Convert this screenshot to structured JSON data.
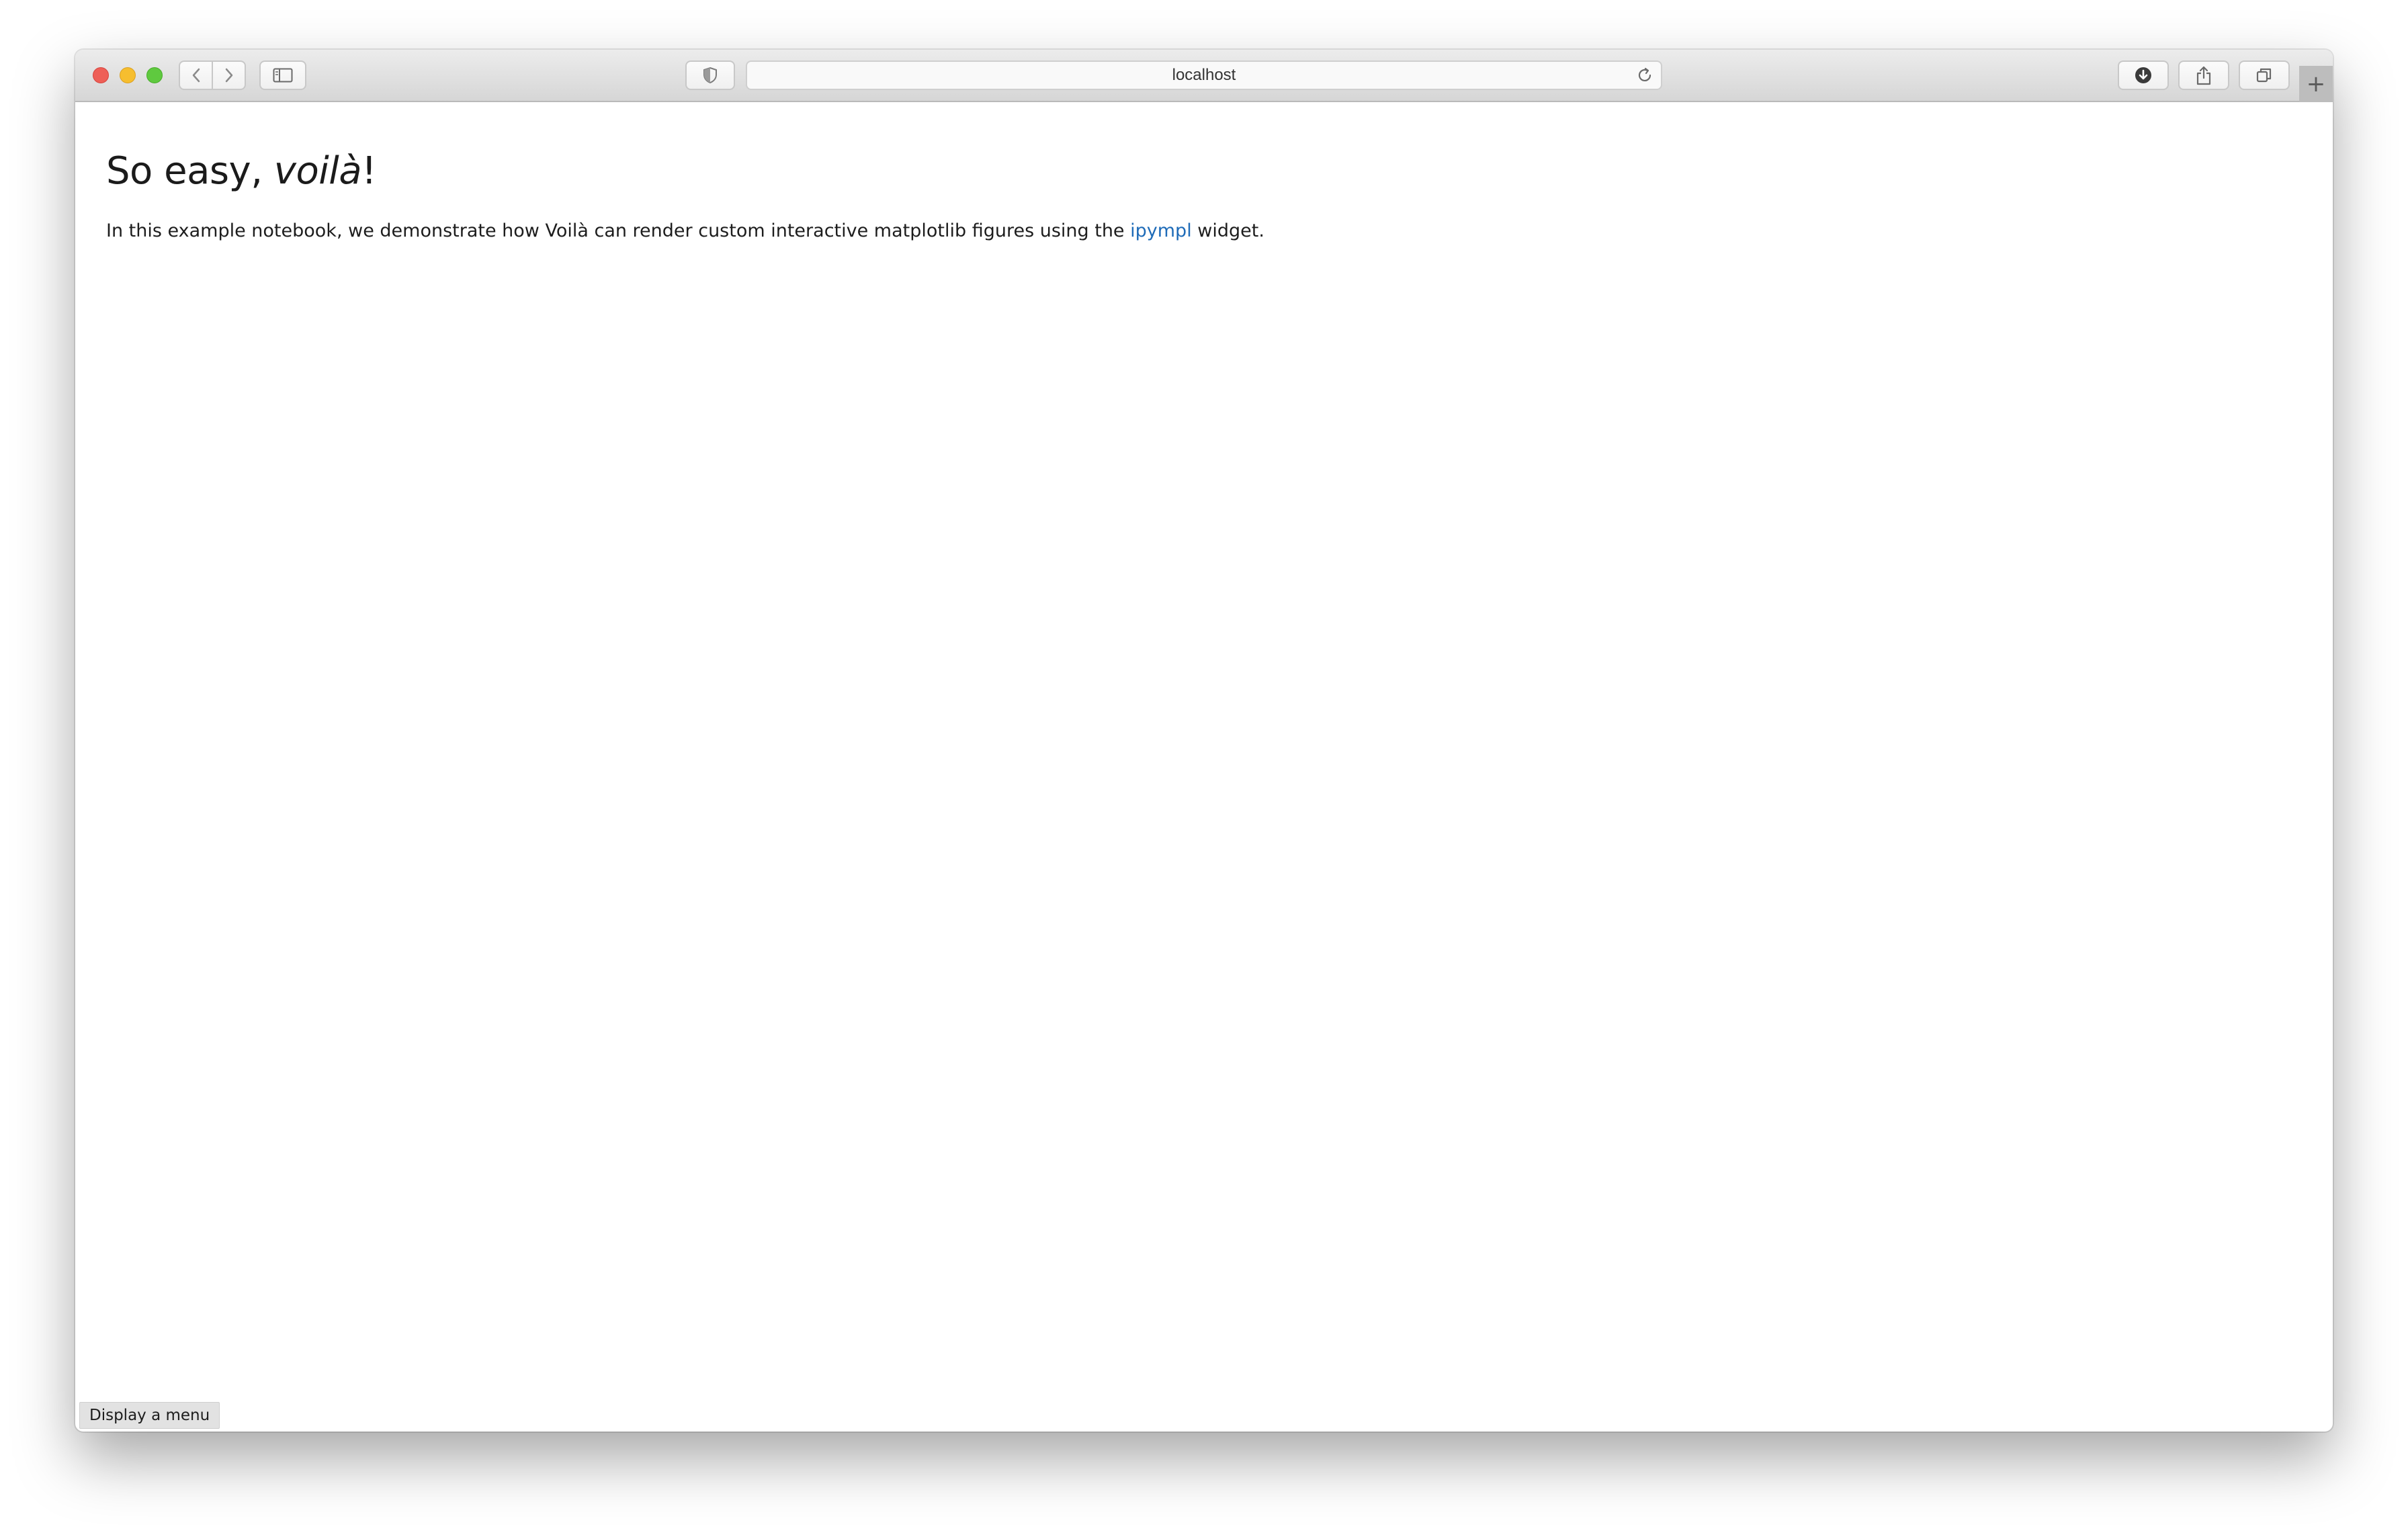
{
  "browser": {
    "url": "localhost",
    "icons": {
      "back": "chevron-left-icon",
      "forward": "chevron-right-icon",
      "sidebar": "sidebar-icon",
      "privacy": "shield-icon",
      "reload": "reload-icon",
      "downloads": "download-icon",
      "share": "share-icon",
      "tabs": "tabs-overview-icon",
      "new_tab": "plus-icon"
    },
    "new_tab_label": "+"
  },
  "page": {
    "title_plain": "So easy, ",
    "title_emphasis": "voilà",
    "title_suffix": "!",
    "intro_before": "In this example notebook, we demonstrate how Voilà can render custom interactive matplotlib figures using the ",
    "intro_link": "ipympl",
    "intro_after": " widget."
  },
  "menu_button": {
    "label": "Display a menu"
  },
  "colors": {
    "link": "#1e6bb8",
    "close": "#ee5f57",
    "minimize": "#f6be2f",
    "maximize": "#5fc93f"
  }
}
